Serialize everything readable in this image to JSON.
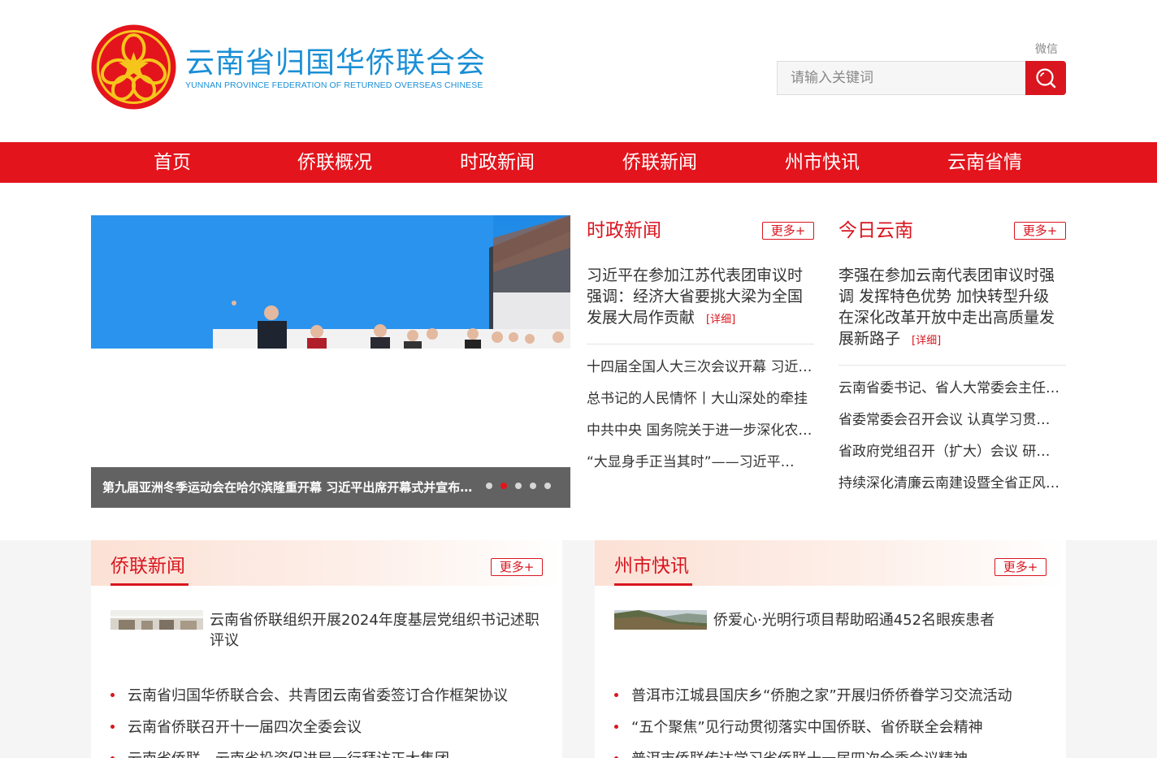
{
  "header": {
    "site_title": "云南省归国华侨联合会",
    "site_subtitle": "YUNNAN PROVINCE FEDERATION OF RETURNED OVERSEAS CHINESE",
    "wechat_label": "微信",
    "search_placeholder": "请输入关键词"
  },
  "nav": {
    "items": [
      "首页",
      "侨联概况",
      "时政新闻",
      "侨联新闻",
      "州市快讯",
      "云南省情"
    ]
  },
  "slider": {
    "caption": "第九届亚洲冬季运动会在哈尔滨隆重开幕 习近平出席开幕式并宣布本届亚冬会开幕",
    "active_dot": 2,
    "dot_count": 5
  },
  "politics": {
    "title": "时政新闻",
    "more_label": "更多+",
    "headline": "习近平在参加江苏代表团审议时强调：经济大省要挑大梁为全国发展大局作贡献",
    "detail_label": "[详细]",
    "items": [
      "十四届全国人大三次会议开幕 习近平等党和国家领导人出席",
      "总书记的人民情怀丨大山深处的牵挂",
      "中共中央 国务院关于进一步深化农村改革扎实推进乡村全面振兴的意见",
      "“大显身手正当其时”——习近平总书记同民营企业家座谈"
    ]
  },
  "yunnan_today": {
    "title": "今日云南",
    "more_label": "更多+",
    "headline": "李强在参加云南代表团审议时强调 发挥特色优势 加快转型升级 在深化改革开放中走出高质量发展新路子",
    "detail_label": "[详细]",
    "items": [
      "云南省委书记、省人大常委会主任王宁参加审议",
      "省委常委会召开会议 认真学习贯彻习近平总书记重要讲话精神",
      "省政府党组召开（扩大）会议 研究部署重点工作",
      "持续深化清廉云南建设暨全省正风肃纪反腐工作会议召开"
    ]
  },
  "qiaolian_news": {
    "title": "侨联新闻",
    "more_label": "更多+",
    "feature": "云南省侨联组织开展2024年度基层党组织书记述职评议",
    "items": [
      "云南省归国华侨联合会、共青团云南省委签订合作框架协议",
      "云南省侨联召开十一届四次全委会议",
      "云南省侨联、云南省投资促进局一行拜访正大集团"
    ]
  },
  "prefecture_news": {
    "title": "州市快讯",
    "more_label": "更多+",
    "feature": "侨爱心·光明行项目帮助昭通452名眼疾患者",
    "items": [
      "普洱市江城县国庆乡“侨胞之家”开展归侨侨眷学习交流活动",
      "“五个聚焦”见行动贯彻落实中国侨联、省侨联全会精神",
      "普洱市侨联传达学习省侨联十一届四次全委会议精神"
    ]
  },
  "colors": {
    "brand_red": "#e3141c",
    "title_blue": "#1a8fd6"
  }
}
